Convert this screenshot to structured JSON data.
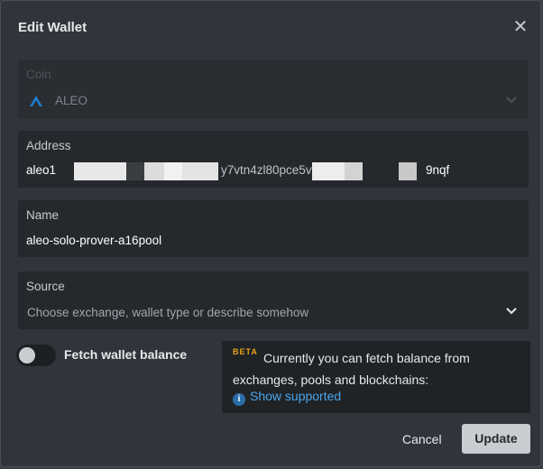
{
  "dialog": {
    "title": "Edit Wallet"
  },
  "colors": {
    "accent_beta": "#e8a317",
    "link": "#4aa3e8",
    "background": "#31353b",
    "field_background": "#25282c"
  },
  "coin": {
    "label": "Coin",
    "value": "ALEO",
    "icon": "aleo-logo-icon"
  },
  "address": {
    "label": "Address",
    "value_start": "aleo1",
    "value_mid": "y7vtn4zl80pce5v4n",
    "value_end": "9nqf"
  },
  "name": {
    "label": "Name",
    "value": "aleo-solo-prover-a16pool"
  },
  "source": {
    "label": "Source",
    "placeholder": "Choose exchange, wallet type or describe somehow"
  },
  "fetch": {
    "label": "Fetch wallet balance",
    "enabled": false
  },
  "info": {
    "badge": "BETA",
    "text": "Currently you can fetch balance from exchanges, pools and blockchains:",
    "link": "Show supported"
  },
  "actions": {
    "cancel": "Cancel",
    "update": "Update"
  }
}
